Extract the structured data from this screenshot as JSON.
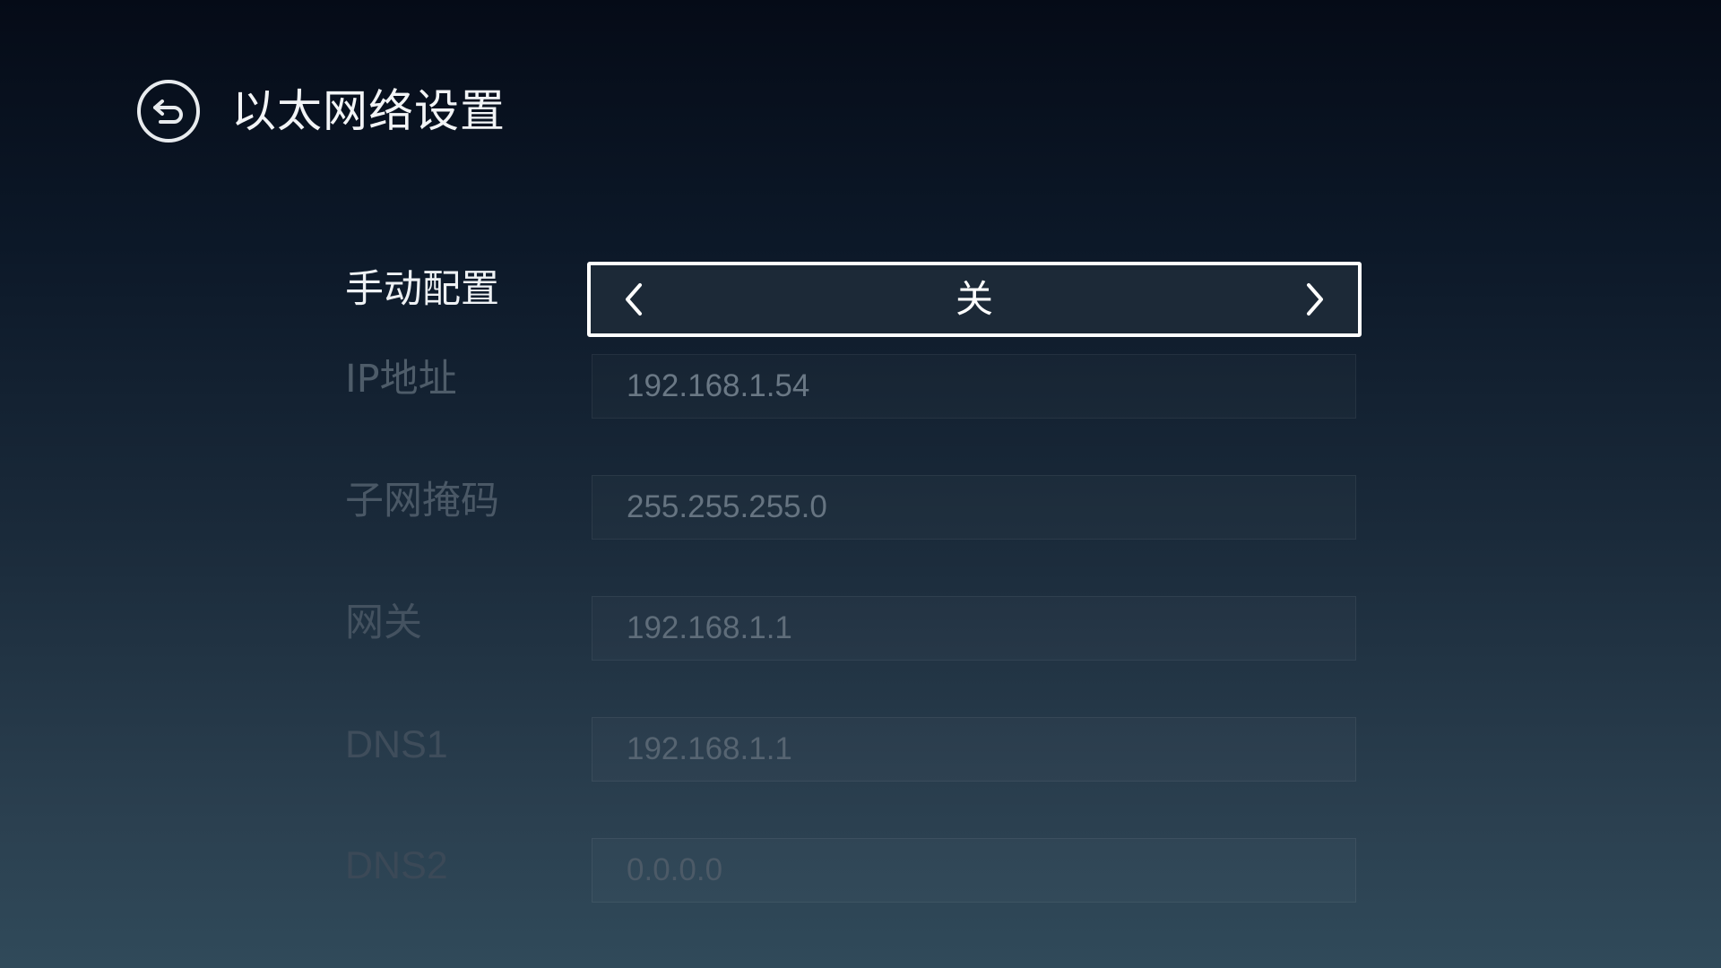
{
  "header": {
    "title": "以太网络设置",
    "back_icon": "back-arrow-circle-icon"
  },
  "manual_config": {
    "label": "手动配置",
    "value": "关",
    "prev_icon": "chevron-left-icon",
    "next_icon": "chevron-right-icon"
  },
  "fields": [
    {
      "label": "IP地址",
      "value": "192.168.1.54"
    },
    {
      "label": "子网掩码",
      "value": "255.255.255.0"
    },
    {
      "label": "网关",
      "value": "192.168.1.1"
    },
    {
      "label": "DNS1",
      "value": "192.168.1.1"
    },
    {
      "label": "DNS2",
      "value": "0.0.0.0"
    }
  ],
  "colors": {
    "focus_border": "#ffffff",
    "active_text": "#f2f4f6",
    "dim_text": "#5f6c78"
  }
}
